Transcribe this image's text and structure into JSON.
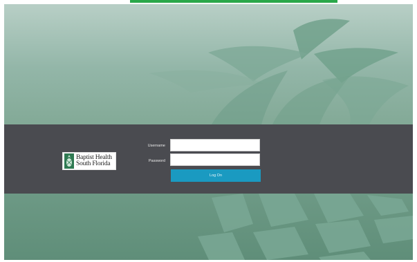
{
  "brand": {
    "line1": "Baptist Health",
    "line2": "South Florida",
    "logo_icon": "pineapple-emblem-icon",
    "accent_top": "#2aa84a"
  },
  "login": {
    "username_label": "Username",
    "password_label": "Password",
    "username_value": "",
    "password_value": "",
    "submit_label": "Log On",
    "button_color": "#1a9ac1",
    "band_color": "#4a4b50"
  },
  "background": {
    "motif": "pineapple-illustration"
  }
}
